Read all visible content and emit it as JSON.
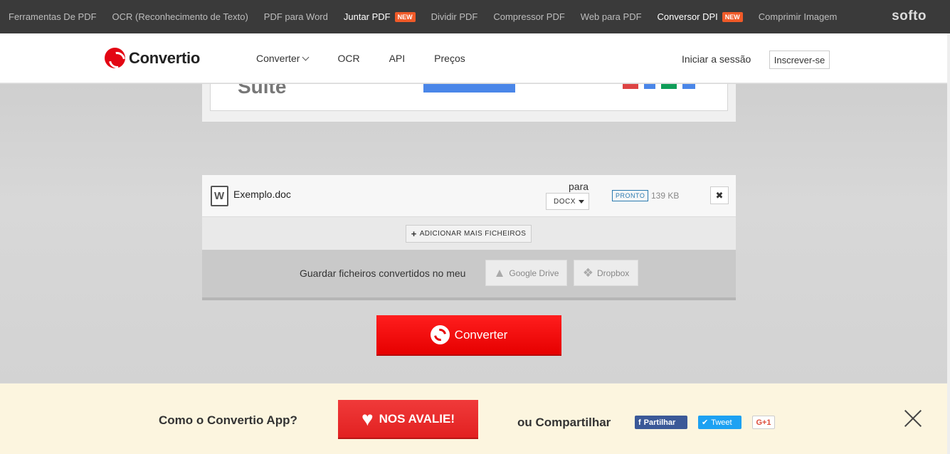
{
  "topbar": {
    "items": [
      {
        "label": "Ferramentas De PDF",
        "bright": false,
        "badge": ""
      },
      {
        "label": "OCR (Reconhecimento de Texto)",
        "bright": false,
        "badge": ""
      },
      {
        "label": "PDF para Word",
        "bright": false,
        "badge": ""
      },
      {
        "label": "Juntar PDF",
        "bright": true,
        "badge": "NEW"
      },
      {
        "label": "Dividir PDF",
        "bright": false,
        "badge": ""
      },
      {
        "label": "Compressor PDF",
        "bright": false,
        "badge": ""
      },
      {
        "label": "Web para PDF",
        "bright": false,
        "badge": ""
      },
      {
        "label": "Conversor DPI",
        "bright": true,
        "badge": "NEW"
      },
      {
        "label": "Comprimir Imagem",
        "bright": false,
        "badge": ""
      }
    ],
    "brand": "softo"
  },
  "header": {
    "logo_text": "Convertio",
    "nav": [
      "Converter",
      "OCR",
      "API",
      "Preços"
    ],
    "login": "Iniciar a sessão",
    "signup": "Inscrever-se"
  },
  "ad": {
    "text": "Suite"
  },
  "file": {
    "name": "Exemplo.doc",
    "to_label": "para",
    "format": "DOCX",
    "status": "PRONTO",
    "size": "139 KB",
    "remove": "✖"
  },
  "add_more": "ADICIONAR MAIS FICHEIROS",
  "save": {
    "label": "Guardar ficheiros convertidos no meu",
    "google_drive": "Google Drive",
    "dropbox": "Dropbox"
  },
  "convert_button": "Converter",
  "rating": {
    "question": "Como o Convertio App?",
    "rate_button": "NOS AVALIE!",
    "share_text": "ou Compartilhar",
    "facebook": "Partilhar",
    "twitter": "Tweet",
    "gplus": "G+1"
  },
  "colors": {
    "brand_red": "#e30613",
    "topbar": "#3a3a3a",
    "new_badge": "#f05a28",
    "status_blue": "#2a7ab0",
    "footer_bg": "#fcf5df"
  }
}
